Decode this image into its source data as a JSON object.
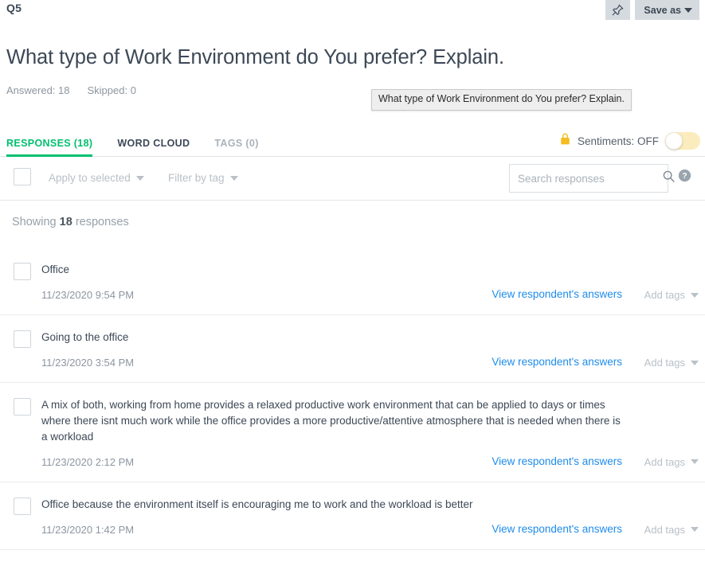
{
  "header": {
    "question_number": "Q5",
    "pin_icon": "pushpin-icon",
    "save_as_label": "Save as",
    "question_title": "What type of Work Environment do You prefer? Explain.",
    "answered_label": "Answered: 18",
    "skipped_label": "Skipped: 0",
    "tooltip_text": "What type of Work Environment do You prefer? Explain."
  },
  "tabs": [
    {
      "label": "RESPONSES (18)",
      "state": "active"
    },
    {
      "label": "WORD CLOUD",
      "state": "idle"
    },
    {
      "label": "TAGS (0)",
      "state": "muted"
    }
  ],
  "sentiments": {
    "lock_icon": "lock-icon",
    "label": "Sentiments: OFF",
    "toggle_state": "off"
  },
  "toolbar": {
    "select_all_checkbox": "unchecked",
    "apply_to_selected_label": "Apply to selected",
    "filter_by_tag_label": "Filter by tag",
    "search_placeholder": "Search responses",
    "search_value": "",
    "search_icon": "search-icon",
    "help_icon": "question-mark-circle-icon"
  },
  "showing": {
    "prefix": "Showing",
    "count": "18",
    "suffix": "responses"
  },
  "responses": [
    {
      "text": "Office",
      "date": "11/23/2020 9:54 PM",
      "view_link": "View respondent's answers",
      "add_tags": "Add tags"
    },
    {
      "text": "Going to the office",
      "date": "11/23/2020 3:54 PM",
      "view_link": "View respondent's answers",
      "add_tags": "Add tags"
    },
    {
      "text": "A mix of both, working from home provides a relaxed productive work environment that can be applied to days or times where there isnt much work while the office provides a more productive/attentive atmosphere that is needed when there is a workload",
      "date": "11/23/2020 2:12 PM",
      "view_link": "View respondent's answers",
      "add_tags": "Add tags"
    },
    {
      "text": "Office because the environment itself is encouraging me to work and the workload is better",
      "date": "11/23/2020 1:42 PM",
      "view_link": "View respondent's answers",
      "add_tags": "Add tags"
    }
  ],
  "colors": {
    "accent_green": "#00bf6f",
    "link_blue": "#1f8ceb",
    "lock_amber": "#f5bc1f",
    "toggle_track": "#fbecbd",
    "text_dark": "#3c4856",
    "text_muted": "#8d96a0",
    "button_grey": "#d5dadf"
  }
}
